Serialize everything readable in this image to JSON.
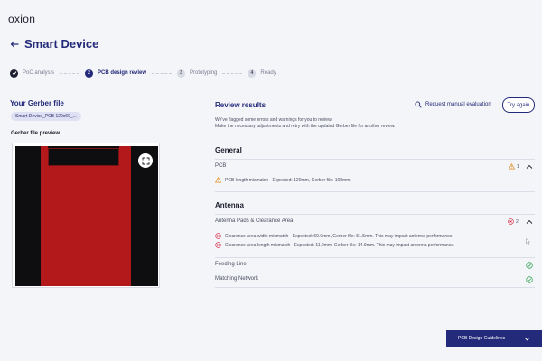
{
  "app": {
    "logo": "oxion"
  },
  "header": {
    "title": "Smart Device"
  },
  "stepper": {
    "steps": [
      {
        "number": "",
        "label": "PoC analysis",
        "state": "done"
      },
      {
        "number": "2",
        "label": "PCB design review",
        "state": "active"
      },
      {
        "number": "3",
        "label": "Prototyping",
        "state": "todo"
      },
      {
        "number": "4",
        "label": "Ready",
        "state": "todo"
      }
    ]
  },
  "left": {
    "title": "Your Gerber file",
    "file_chip": "Smart Device_PCB 120x60_...",
    "preview_label": "Gerber file preview"
  },
  "review": {
    "title": "Review results",
    "manual_label": "Request manual evaluation",
    "try_again": "Try again",
    "description_1": "We've flagged some errors and warnings for you to review.",
    "description_2": "Make the necessary adjustments and retry with the updated Gerber file for another review.",
    "general": {
      "heading": "General",
      "pcb": {
        "label": "PCB",
        "warning_count": "1",
        "issue": "PCB length mismatch - Expected: 120mm, Gerber file: 108mm."
      }
    },
    "antenna": {
      "heading": "Antenna",
      "pads": {
        "label": "Antenna Pads & Clearance Area",
        "error_count": "2",
        "issues": [
          "Clearance Area width mismatch - Expected: 60.0mm, Gerber file: 51.5mm. This may impact antenna performance.",
          "Clearance Area length mismatch - Expected: 11.0mm, Gerber file: 14.9mm. This may impact antenna performance."
        ]
      },
      "feeding": {
        "label": "Feeding Line"
      },
      "matching": {
        "label": "Matching Network"
      }
    }
  },
  "footer": {
    "guidelines_label": "PCB Design Guidelines"
  },
  "colors": {
    "brand": "#232a7a",
    "warning": "#e08a1e",
    "error": "#d9324a",
    "success": "#3aa65b",
    "pcb": "#b3191b"
  }
}
